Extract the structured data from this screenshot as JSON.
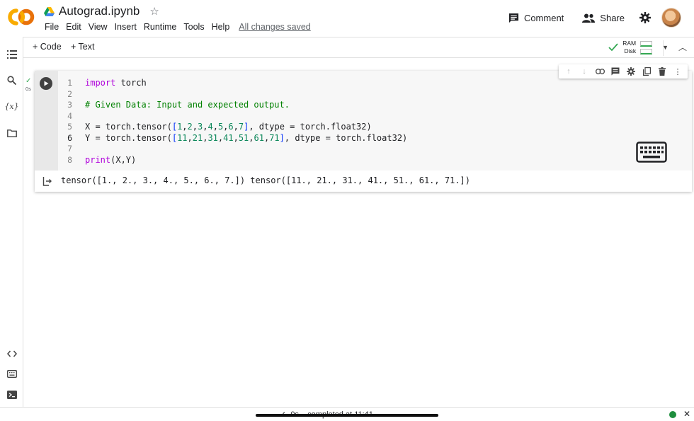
{
  "header": {
    "logo_text": "CO",
    "notebook_title": "Autograd.ipynb",
    "menu": [
      "File",
      "Edit",
      "View",
      "Insert",
      "Runtime",
      "Tools",
      "Help"
    ],
    "save_status": "All changes saved",
    "comment_label": "Comment",
    "share_label": "Share"
  },
  "toolbar": {
    "add_code_label": "+ Code",
    "add_text_label": "+ Text",
    "ram_label": "RAM",
    "disk_label": "Disk"
  },
  "cell": {
    "status_check": "✓",
    "status_time": "0s",
    "lines": [
      {
        "num": "1",
        "text": "import torch"
      },
      {
        "num": "2",
        "text": ""
      },
      {
        "num": "3",
        "text": "# Given Data: Input and expected output."
      },
      {
        "num": "4",
        "text": ""
      },
      {
        "num": "5",
        "text": "X = torch.tensor([1,2,3,4,5,6,7], dtype = torch.float32)"
      },
      {
        "num": "6",
        "text": "Y = torch.tensor([11,21,31,41,51,61,71], dtype = torch.float32)"
      },
      {
        "num": "7",
        "text": ""
      },
      {
        "num": "8",
        "text": "print(X,Y)"
      }
    ],
    "output": "tensor([1., 2., 3., 4., 5., 6., 7.]) tensor([11., 21., 31., 41., 51., 61., 71.])"
  },
  "statusbar": {
    "text": "✓  0s    completed at 11:41"
  },
  "colors": {
    "accent_orange": "#f9ab00",
    "accent_orange_dark": "#e8710a",
    "success_green": "#34a853",
    "keyword_purple": "#af00db",
    "comment_green": "#008000"
  }
}
